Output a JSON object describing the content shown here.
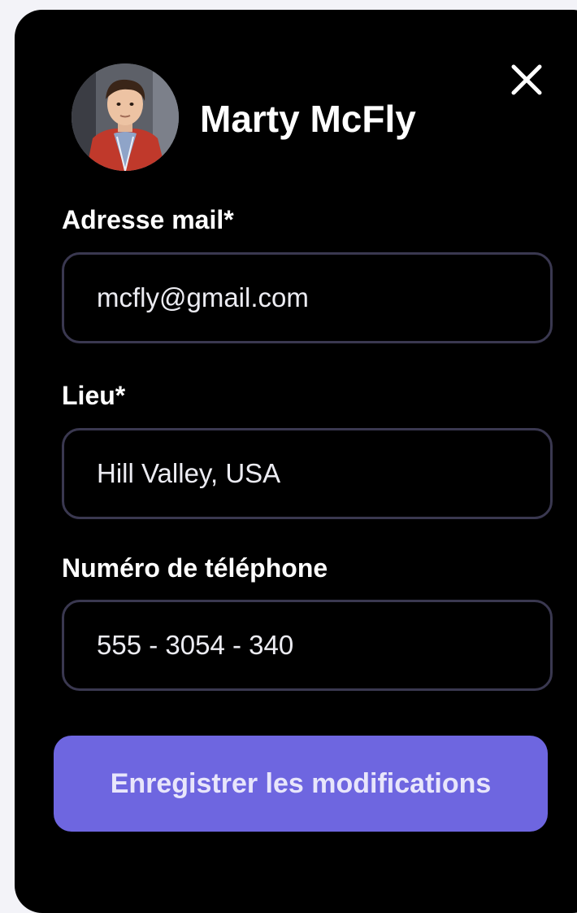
{
  "profile": {
    "name": "Marty McFly",
    "avatar_icon": "user-avatar-photo"
  },
  "close_icon": "close-icon",
  "form": {
    "email": {
      "label": "Adresse mail*",
      "value": "mcfly@gmail.com"
    },
    "location": {
      "label": "Lieu*",
      "value": "Hill Valley, USA"
    },
    "phone": {
      "label": "Numéro de téléphone",
      "value": "555 - 3054 - 340"
    }
  },
  "actions": {
    "save_label": "Enregistrer les modifications"
  },
  "colors": {
    "panel_bg": "#000000",
    "page_bg": "#f3f3f8",
    "field_border": "#3a3850",
    "accent": "#6e66e0"
  }
}
